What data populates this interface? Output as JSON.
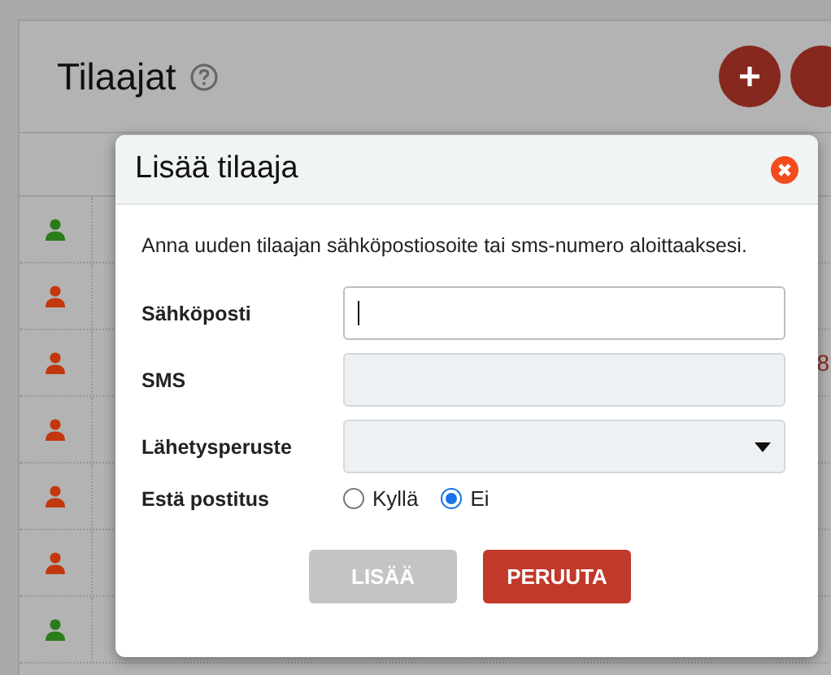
{
  "page": {
    "title": "Tilaajat",
    "rows": [
      {
        "color": "#2a7d18"
      },
      {
        "color": "#c2380e"
      },
      {
        "color": "#c2380e",
        "column_3": "8"
      },
      {
        "color": "#c2380e"
      },
      {
        "color": "#c2380e"
      },
      {
        "color": "#c2380e"
      },
      {
        "color": "#2a7d18"
      }
    ]
  },
  "dialog": {
    "title": "Lisää tilaaja",
    "intro": "Anna uuden tilaajan sähköpostiosoite tai sms-numero aloittaaksesi.",
    "fields": [
      {
        "kind": "text",
        "label": "Sähköposti",
        "focused": true
      },
      {
        "kind": "text",
        "label": "SMS",
        "focused": false
      },
      {
        "kind": "select",
        "label": "Lähetysperuste",
        "focused": false
      },
      {
        "kind": "radio",
        "label": "Estä postitus",
        "options": [
          {
            "label": "Kyllä",
            "selected": false
          },
          {
            "label": "Ei",
            "selected": true
          }
        ]
      }
    ],
    "buttons": [
      {
        "label": "LISÄÄ",
        "disabled": true
      },
      {
        "label": "PERUUTA",
        "disabled": false
      }
    ]
  }
}
